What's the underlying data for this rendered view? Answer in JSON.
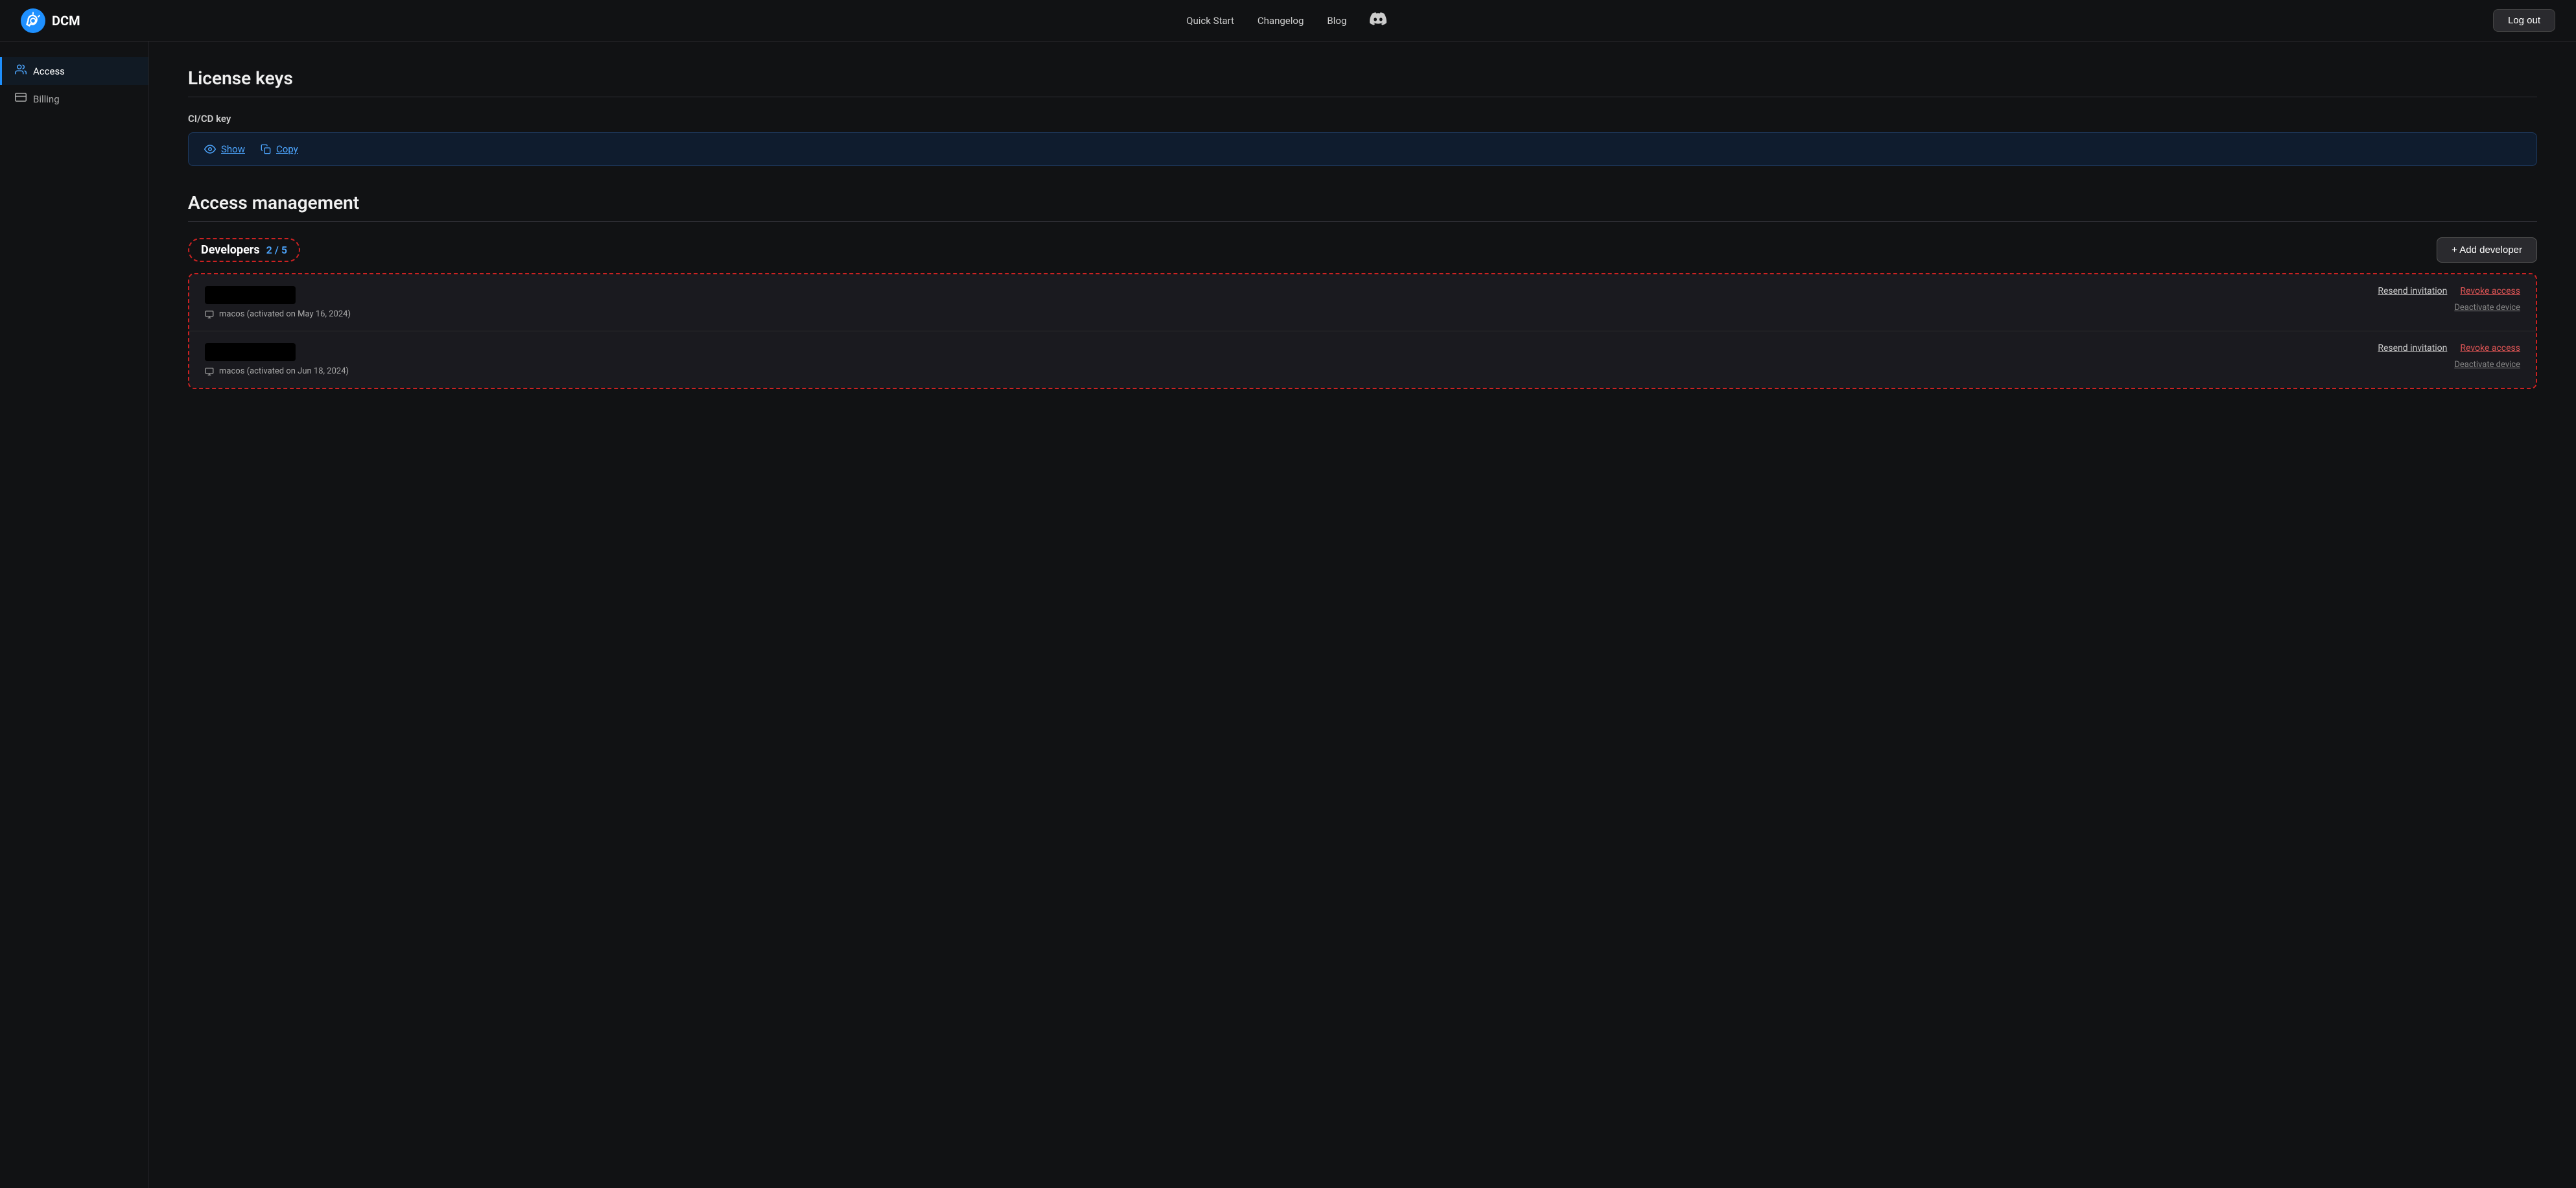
{
  "header": {
    "logo_text": "DCM",
    "nav": [
      {
        "label": "Quick Start"
      },
      {
        "label": "Changelog"
      },
      {
        "label": "Blog"
      }
    ],
    "logout_label": "Log out",
    "discord_symbol": "🎮"
  },
  "sidebar": {
    "items": [
      {
        "label": "Access",
        "icon": "👤",
        "active": true
      },
      {
        "label": "Billing",
        "icon": "💳",
        "active": false
      }
    ]
  },
  "main": {
    "license_keys": {
      "title": "License keys",
      "cicd_key_label": "CI/CD key",
      "show_label": "Show",
      "copy_label": "Copy"
    },
    "access_management": {
      "title": "Access management",
      "developers_label": "Developers",
      "developers_count": "2 / 5",
      "add_developer_label": "+ Add developer",
      "developers": [
        {
          "device": "macos (activated on May 16, 2024)",
          "resend_label": "Resend invitation",
          "revoke_label": "Revoke access",
          "deactivate_label": "Deactivate device"
        },
        {
          "device": "macos (activated on Jun 18, 2024)",
          "resend_label": "Resend invitation",
          "revoke_label": "Revoke access",
          "deactivate_label": "Deactivate device"
        }
      ]
    }
  }
}
